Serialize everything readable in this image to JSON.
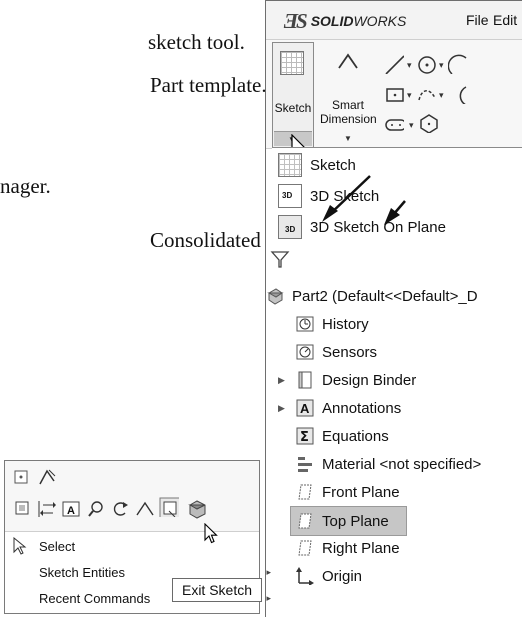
{
  "book": {
    "lines": [
      "sketch tool.",
      "Part template.",
      "nager.",
      "Consolidated"
    ]
  },
  "app": {
    "brand_bold": "SOLID",
    "brand_italic": "WORKS",
    "menu": [
      "File",
      "Edit"
    ]
  },
  "ribbon": {
    "sketch_label": "Sketch",
    "smartdim_label_1": "Smart",
    "smartdim_label_2": "Dimension"
  },
  "dropdown": {
    "items": [
      "Sketch",
      "3D Sketch",
      "3D Sketch On Plane"
    ]
  },
  "tree": {
    "root": "Part2  (Default<<Default>_D",
    "items": [
      "History",
      "Sensors",
      "Design Binder",
      "Annotations",
      "Equations",
      "Material <not specified>",
      "Front Plane",
      "Top Plane",
      "Right Plane",
      "Origin"
    ],
    "selected": "Top Plane"
  },
  "context_menu": {
    "items": [
      "Select",
      "Sketch Entities",
      "Recent Commands"
    ],
    "tooltip": "Exit Sketch"
  },
  "icons": [
    "sketch-grid-icon",
    "smart-dimension-icon",
    "line-icon",
    "circle-icon",
    "arc-icon",
    "rectangle-icon",
    "spline-icon",
    "slot-icon",
    "polygon-icon",
    "filter-icon",
    "part-icon",
    "history-icon",
    "sensors-icon",
    "design-binder-icon",
    "annotations-icon",
    "equations-icon",
    "material-icon",
    "plane-icon",
    "origin-icon",
    "arrow-cursor-icon"
  ]
}
